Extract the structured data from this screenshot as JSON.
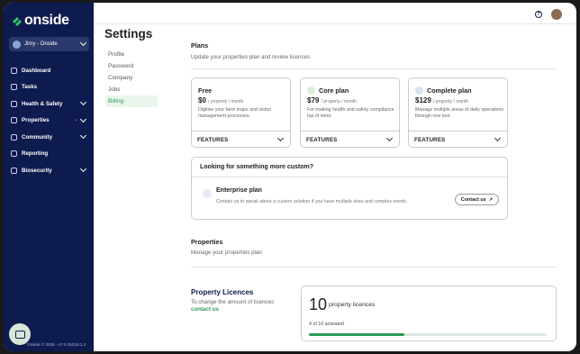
{
  "sidebar": {
    "brand": "onside",
    "farm": "Jimy - Onside",
    "items": [
      {
        "label": "Dashboard",
        "icon": "dashboard-icon",
        "chevron": false,
        "dot": false
      },
      {
        "label": "Tasks",
        "icon": "tasks-icon",
        "chevron": false,
        "dot": false
      },
      {
        "label": "Health & Safety",
        "icon": "health-safety-icon",
        "chevron": true,
        "dot": false
      },
      {
        "label": "Properties",
        "icon": "properties-icon",
        "chevron": true,
        "dot": true
      },
      {
        "label": "Community",
        "icon": "community-icon",
        "chevron": true,
        "dot": false
      },
      {
        "label": "Reporting",
        "icon": "reporting-icon",
        "chevron": false,
        "dot": false
      },
      {
        "label": "Biosecurity",
        "icon": "biosecurity-icon",
        "chevron": true,
        "dot": false
      }
    ],
    "footer": "Onside © 2025 - v7.0.25219.1.2"
  },
  "page": {
    "title": "Settings",
    "subnav": [
      "Profile",
      "Password",
      "Company",
      "Jobs",
      "Billing"
    ],
    "active_subnav": "Billing"
  },
  "plans": {
    "title": "Plans",
    "subtitle": "Update your properties plan and review licences",
    "cards": [
      {
        "name": "Free",
        "price": "$0",
        "unit": "/ property / month",
        "desc": "Digitise your farm maps and visitor management processes.",
        "features": "FEATURES",
        "badge_color": ""
      },
      {
        "name": "Core plan",
        "price": "$79",
        "unit": "/ property / month",
        "desc": "For making health and safety compliance top of mind.",
        "features": "FEATURES",
        "badge_color": "#d9efdc"
      },
      {
        "name": "Complete plan",
        "price": "$129",
        "unit": "/ property / month",
        "desc": "Manage multiple areas of daily operations through one tool.",
        "features": "FEATURES",
        "badge_color": "#dbe2f3"
      }
    ]
  },
  "custom": {
    "title": "Looking for something more custom?",
    "plan_name": "Enterprise plan",
    "desc": "Contact us to speak about a custom solution if you have multiple sites and complex needs.",
    "button": "Contact us",
    "button_icon": "external-arrow-icon"
  },
  "properties": {
    "title": "Properties",
    "subtitle": "Manage your properties plan"
  },
  "licences": {
    "title": "Property Licences",
    "text": "To change the amount of licences",
    "link": "contact us",
    "count": "10",
    "count_label": "property licences",
    "activated_text": "4 of 10 activated",
    "activated_fraction": 0.4
  },
  "colors": {
    "sidebar": "#0d1b4f",
    "accent": "#2e9a58"
  }
}
